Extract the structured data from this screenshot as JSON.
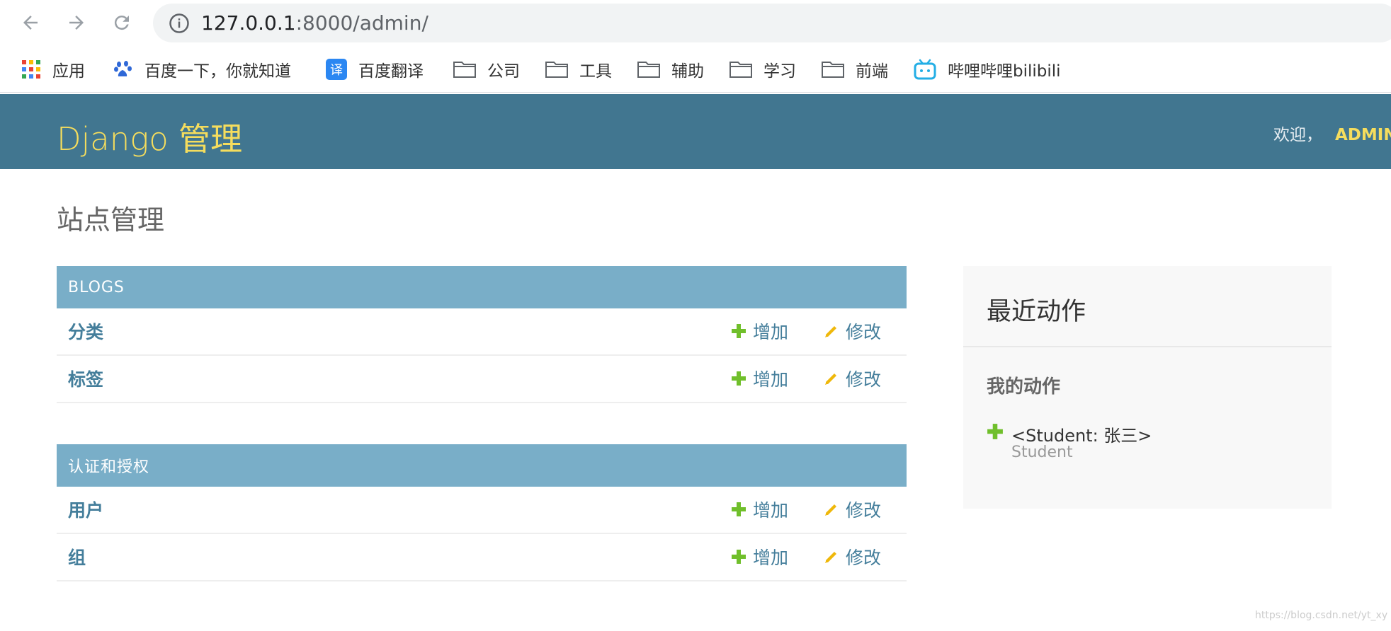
{
  "browser": {
    "url_host": "127.0.0.1",
    "url_rest": ":8000/admin/",
    "bookmarks": [
      {
        "label": "应用",
        "icon": "apps-grid-icon"
      },
      {
        "label": "百度一下，你就知道",
        "icon": "baidu-paw-icon"
      },
      {
        "label": "百度翻译",
        "icon": "baidu-translate-icon"
      },
      {
        "label": "公司",
        "icon": "folder-icon"
      },
      {
        "label": "工具",
        "icon": "folder-icon"
      },
      {
        "label": "辅助",
        "icon": "folder-icon"
      },
      {
        "label": "学习",
        "icon": "folder-icon"
      },
      {
        "label": "前端",
        "icon": "folder-icon"
      },
      {
        "label": "哔哩哔哩bilibili",
        "icon": "bilibili-tv-icon"
      }
    ]
  },
  "header": {
    "brand": "Django 管理",
    "welcome": "欢迎，",
    "username": "ADMIN"
  },
  "content": {
    "title": "站点管理",
    "add_label": "增加",
    "change_label": "修改",
    "apps": [
      {
        "caption": "BLOGS",
        "models": [
          "分类",
          "标签"
        ]
      },
      {
        "caption": "认证和授权",
        "models": [
          "用户",
          "组"
        ]
      }
    ]
  },
  "recent_actions": {
    "title": "最近动作",
    "subtitle": "我的动作",
    "items": [
      {
        "title": "<Student: 张三>",
        "type": "Student",
        "action": "add"
      }
    ]
  },
  "watermark": "https://blog.csdn.net/yt_xy",
  "colors": {
    "header_bg": "#417690",
    "brand": "#f5dd5d",
    "caption_bg": "#79aec8",
    "link": "#447e9b",
    "add_green": "#70bf2b",
    "change_yellow": "#efb80b"
  }
}
